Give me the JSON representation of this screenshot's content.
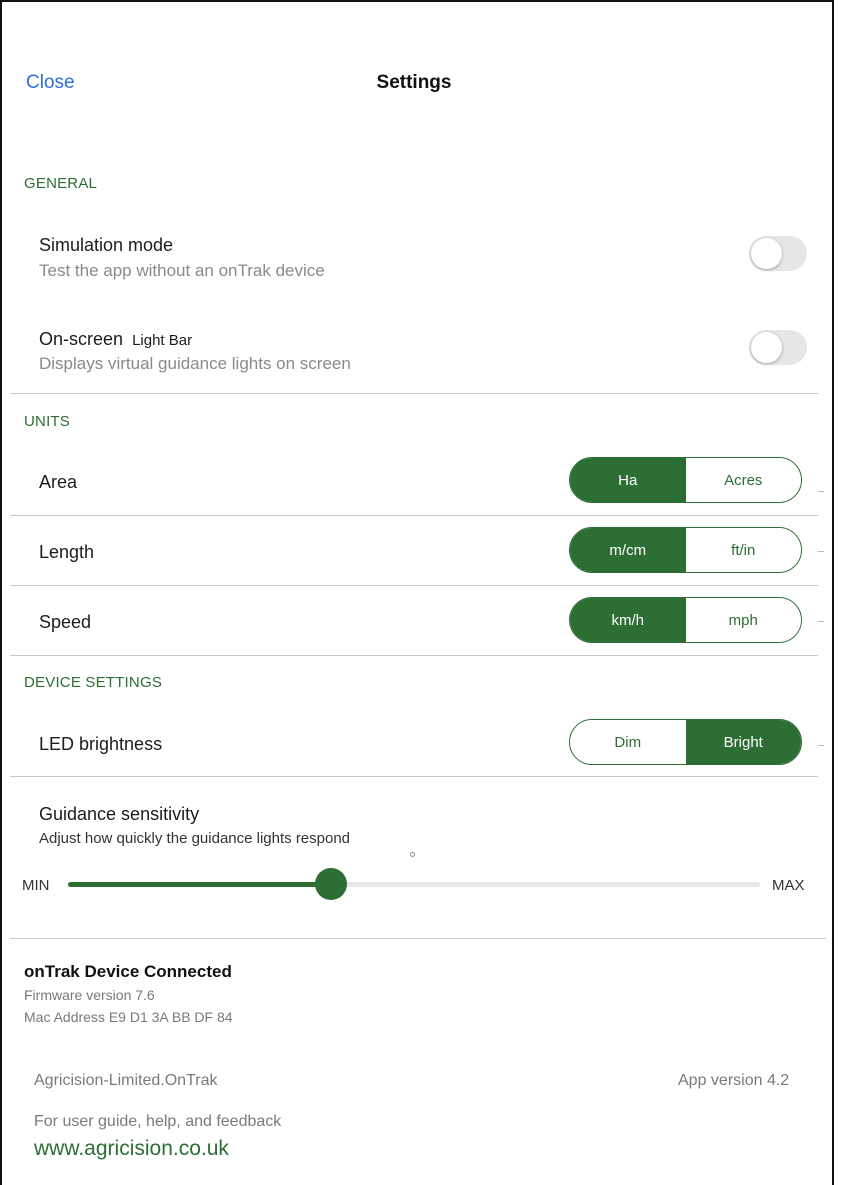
{
  "header": {
    "close_label": "Close",
    "title": "Settings"
  },
  "general": {
    "label": "GENERAL",
    "simulation": {
      "title": "Simulation mode",
      "subtitle": "Test the app without an onTrak device",
      "on": false
    },
    "light_bar": {
      "title_prefix": "On-screen",
      "title_suffix": "Light Bar",
      "subtitle": "Displays virtual guidance lights on screen",
      "on": false
    }
  },
  "units": {
    "label": "UNITS",
    "area": {
      "title": "Area",
      "options": [
        "Ha",
        "Acres"
      ],
      "selected": "Ha"
    },
    "length": {
      "title": "Length",
      "options": [
        "m/cm",
        "ft/in"
      ],
      "selected": "m/cm"
    },
    "speed": {
      "title": "Speed",
      "options": [
        "km/h",
        "mph"
      ],
      "selected": "km/h"
    }
  },
  "device": {
    "label": "DEVICE SETTINGS",
    "led": {
      "title": "LED brightness",
      "options": [
        "Dim",
        "Bright"
      ],
      "selected": "Bright"
    },
    "sensitivity": {
      "title": "Guidance sensitivity",
      "subtitle": "Adjust how quickly the guidance lights respond",
      "min_label": "MIN",
      "max_label": "MAX",
      "level": 0.38
    }
  },
  "footer": {
    "status": "onTrak Device Connected",
    "firmware": "Firmware version 7.6",
    "mac": "Mac Address E9 D1 3A BB DF 84",
    "bundle": "Agricision-Limited.OnTrak",
    "app_version": "App version 4.2",
    "help_text": "For user guide, help, and feedback",
    "website": "www.agricision.co.uk"
  },
  "colors": {
    "accent": "#2d6e34",
    "link_blue": "#2f6fe0",
    "toggle_off": "#e6e6e6"
  }
}
